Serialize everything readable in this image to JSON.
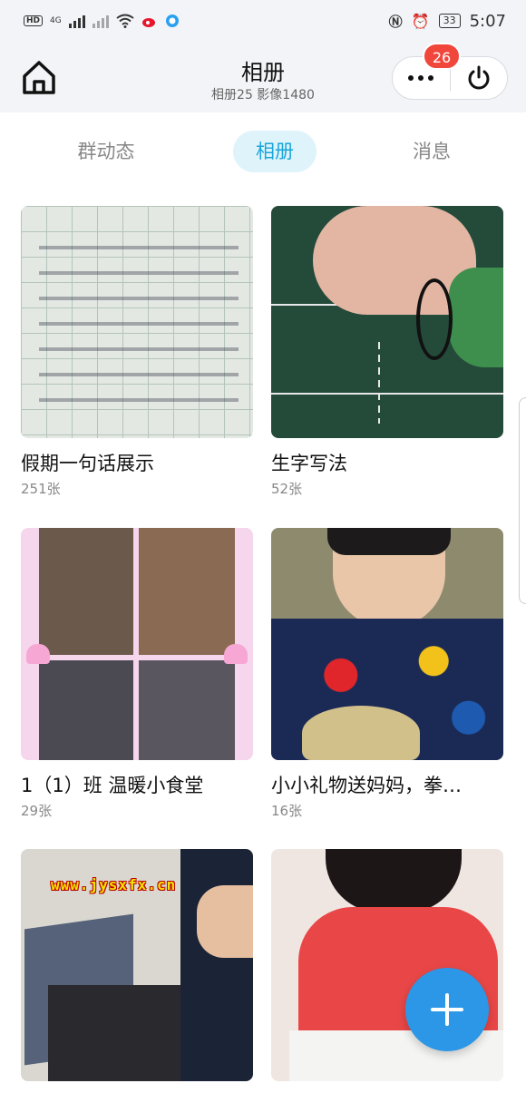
{
  "status_bar": {
    "hd": "HD",
    "network": "4G",
    "battery": "33",
    "time": "5:07"
  },
  "header": {
    "title": "相册",
    "subtitle": "相册25 影像1480",
    "notification_count": "26"
  },
  "tabs": [
    {
      "label": "群动态",
      "active": false
    },
    {
      "label": "相册",
      "active": true
    },
    {
      "label": "消息",
      "active": false
    }
  ],
  "albums": [
    {
      "title": "假期一句话展示",
      "count": "251张"
    },
    {
      "title": "生字写法",
      "count": "52张"
    },
    {
      "title": "1（1）班 温暖小食堂",
      "count": "29张"
    },
    {
      "title": "小小礼物送妈妈，拳…",
      "count": "16张"
    },
    {
      "title": "",
      "count": ""
    },
    {
      "title": "",
      "count": ""
    }
  ],
  "watermark": "www.jysxfx.cn",
  "colors": {
    "accent": "#1aa6d9",
    "active_tab_bg": "#dff3fb",
    "badge": "#f0463b",
    "fab": "#2b97e6"
  },
  "icons": {
    "home": "home-icon",
    "more": "more-dots-icon",
    "power": "power-icon",
    "add": "plus-icon"
  }
}
